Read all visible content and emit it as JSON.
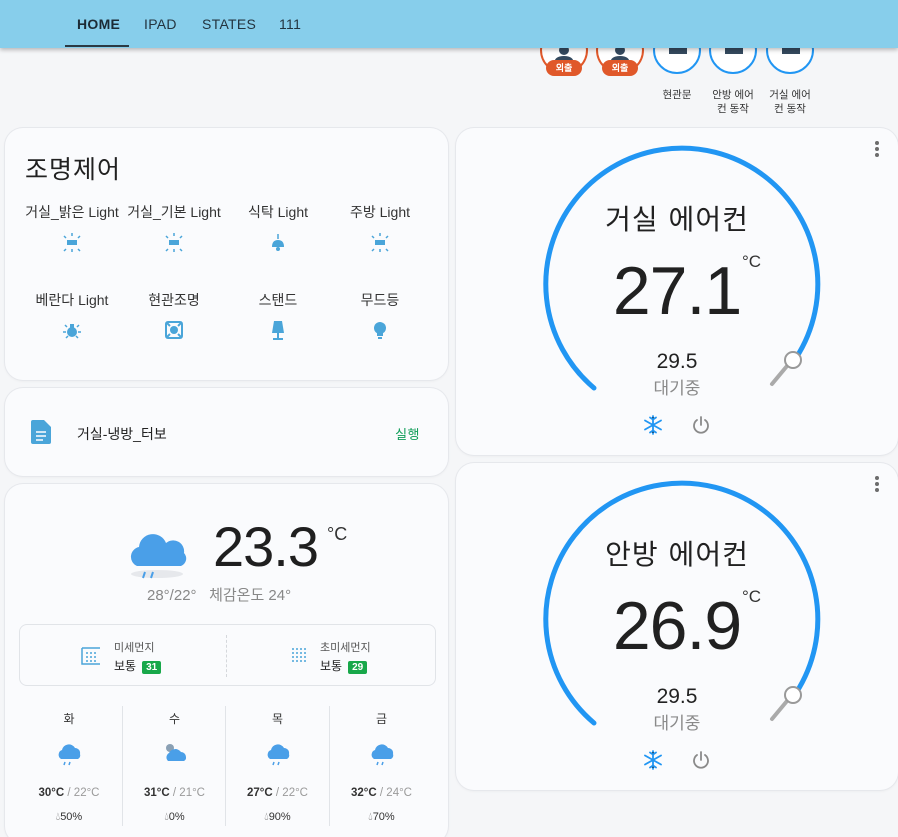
{
  "tabs": [
    {
      "label": "HOME",
      "active": true
    },
    {
      "label": "IPAD",
      "active": false
    },
    {
      "label": "STATES",
      "active": false
    },
    {
      "label": "111",
      "active": false
    }
  ],
  "badges": [
    {
      "type": "person",
      "state_label": "외출",
      "label": ""
    },
    {
      "type": "person",
      "state_label": "외출",
      "label": ""
    },
    {
      "type": "door",
      "label": "현관문"
    },
    {
      "type": "switch",
      "label": "안방 에어\n컨 동작"
    },
    {
      "type": "switch",
      "label": "거실 에어\n컨 동작"
    }
  ],
  "lights": {
    "title": "조명제어",
    "items": [
      {
        "label": "거실_밝은 Light",
        "icon": "ceiling-light-icon"
      },
      {
        "label": "거실_기본 Light",
        "icon": "ceiling-light-icon"
      },
      {
        "label": "식탁 Light",
        "icon": "pendant-light-icon"
      },
      {
        "label": "주방 Light",
        "icon": "ceiling-light-icon"
      },
      {
        "label": "베란다 Light",
        "icon": "bulb-on-icon"
      },
      {
        "label": "현관조명",
        "icon": "spotlight-icon"
      },
      {
        "label": "스탠드",
        "icon": "floor-lamp-icon"
      },
      {
        "label": "무드등",
        "icon": "lightbulb-icon"
      }
    ]
  },
  "script": {
    "name": "거실-냉방_터보",
    "action": "실행",
    "icon": "script-file-icon"
  },
  "weather": {
    "temperature": "23.3",
    "unit": "°C",
    "hilo": "28°/22°",
    "feels_like": "체감온도 24°",
    "condition_icon": "rainy-cloud-icon",
    "air": [
      {
        "name": "미세먼지",
        "status": "보통",
        "value": "31"
      },
      {
        "name": "초미세먼지",
        "status": "보통",
        "value": "29"
      }
    ],
    "forecast": [
      {
        "day": "화",
        "high": "30°C",
        "low": "22°C",
        "rain": "50%",
        "icon": "rainy-cloud-icon"
      },
      {
        "day": "수",
        "high": "31°C",
        "low": "21°C",
        "rain": "0%",
        "icon": "partly-cloudy-icon"
      },
      {
        "day": "목",
        "high": "27°C",
        "low": "22°C",
        "rain": "90%",
        "icon": "rainy-cloud-icon"
      },
      {
        "day": "금",
        "high": "32°C",
        "low": "24°C",
        "rain": "70%",
        "icon": "rainy-cloud-icon"
      }
    ]
  },
  "climates": [
    {
      "name": "거실 에어컨",
      "current": "27.1",
      "unit": "°C",
      "target": "29.5",
      "status": "대기중"
    },
    {
      "name": "안방 에어컨",
      "current": "26.9",
      "unit": "°C",
      "target": "29.5",
      "status": "대기중"
    }
  ],
  "colors": {
    "header": "#87ceeb",
    "accent": "#2196f3",
    "icon_blue": "#4aa5d9",
    "away": "#e0582a",
    "ok_green": "#18a84a"
  }
}
